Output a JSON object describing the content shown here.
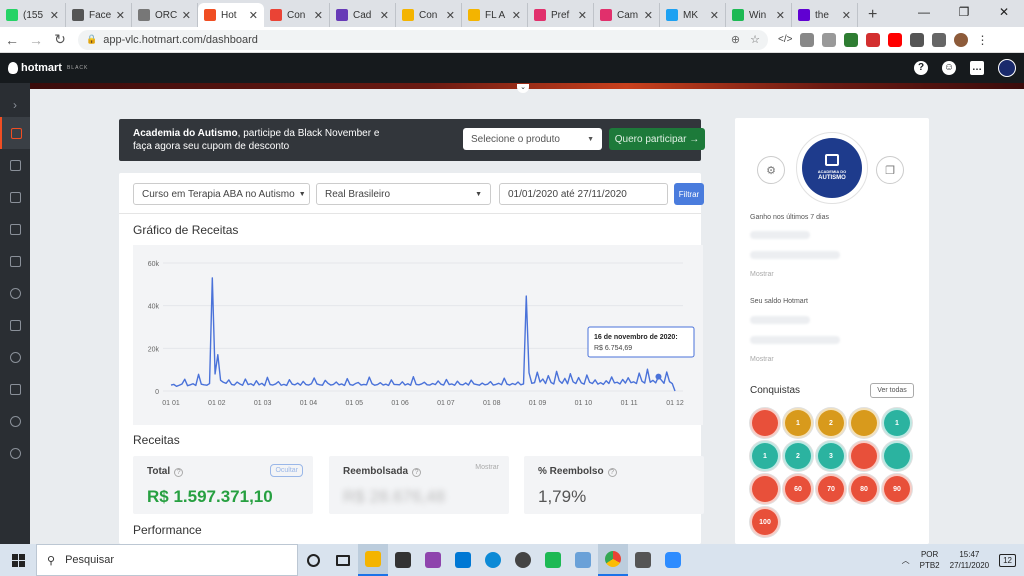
{
  "browser": {
    "tabs": [
      {
        "label": "(155",
        "color": "#25d366"
      },
      {
        "label": "Face",
        "color": "#555555"
      },
      {
        "label": "ORC",
        "color": "#777777"
      },
      {
        "label": "Hot",
        "color": "#f04e23"
      },
      {
        "label": "Con",
        "color": "#ea4335"
      },
      {
        "label": "Cad",
        "color": "#673ab7"
      },
      {
        "label": "Con",
        "color": "#f4b400"
      },
      {
        "label": "FL A",
        "color": "#f4b400"
      },
      {
        "label": "Pref",
        "color": "#e1306c"
      },
      {
        "label": "Cam",
        "color": "#e1306c"
      },
      {
        "label": "MK",
        "color": "#1da1f2"
      },
      {
        "label": "Win",
        "color": "#1db954"
      },
      {
        "label": "the",
        "color": "#6001d2"
      }
    ],
    "active_tab_index": 3,
    "new_tab": "+",
    "url": "app-vlc.hotmart.com/dashboard"
  },
  "header": {
    "logo": "hotmart",
    "logo_sub": "BLACK"
  },
  "banner": {
    "bold": "Academia do Autismo",
    "text": ", participe da Black November e faça agora seu cupom de desconto",
    "product_select": "Selecione o produto",
    "cta": "Quero participar →"
  },
  "filters": {
    "product": "Curso em Terapia ABA no Autismo",
    "currency": "Real Brasileiro",
    "date_range": "01/01/2020 até 27/11/2020",
    "filter_button": "Filtrar"
  },
  "chart_title": "Gráfico de Receitas",
  "chart_data": {
    "type": "line",
    "x_ticks": [
      "01 01",
      "01 02",
      "01 03",
      "01 04",
      "01 05",
      "01 06",
      "01 07",
      "01 08",
      "01 09",
      "01 10",
      "01 11",
      "01 12"
    ],
    "y_ticks": [
      "0",
      "20k",
      "40k",
      "60k"
    ],
    "ylim": [
      0,
      60000
    ],
    "color": "#4a72d9",
    "series": [
      {
        "values": [
          2800,
          3100,
          2200,
          2700,
          3300,
          5500,
          2500,
          2900,
          3400,
          2600,
          7800,
          3200,
          2900,
          2700,
          3500,
          53000,
          8000,
          17000,
          5000,
          4100,
          3600,
          5200,
          3100,
          2800,
          4200,
          3300,
          2700,
          5600,
          3000,
          3400,
          2600,
          4800,
          2900,
          3600,
          2500,
          6400,
          3000,
          2800,
          3300,
          4400,
          2700,
          3100,
          2600,
          5300,
          3200,
          2900,
          3700,
          2700,
          4500,
          3000,
          2800,
          3400,
          6100,
          3300,
          2900,
          2700,
          5000,
          3600,
          2800,
          3100,
          4200,
          2900,
          3300,
          2600,
          5800,
          3000,
          2700,
          3500,
          4000,
          2800,
          3100,
          2900,
          6500,
          3400,
          2700,
          3000,
          3900,
          2800,
          3200,
          2600,
          5200,
          3100,
          3000,
          2900,
          4300,
          2800,
          3400,
          2700,
          6700,
          3100,
          2900,
          3300,
          4100,
          2900,
          2800,
          3500,
          3000,
          4700,
          3200,
          2800,
          5400,
          3000,
          3300,
          2700,
          4600,
          3100,
          2900,
          3800,
          2800,
          5100,
          3300,
          3000,
          2700,
          3700,
          2900,
          3200,
          4400,
          2800,
          3100,
          3600,
          2900,
          6000,
          3200,
          2800,
          3500,
          3000,
          4200,
          2900,
          3300,
          44500,
          8500,
          3600,
          3900,
          8800,
          4200,
          5600,
          3500,
          7200,
          4000,
          3300,
          9200,
          4800,
          3600,
          5900,
          3400,
          8100,
          4300,
          3500,
          6300,
          3800,
          3200,
          7500,
          4100,
          3500,
          5200,
          3200,
          3900,
          3100,
          4800,
          3500,
          6600,
          3800,
          4100,
          3300,
          5400,
          3700,
          6200,
          3900,
          4300,
          3500,
          8400,
          4600,
          3700,
          10200,
          4100,
          5000,
          3800,
          6754,
          5200,
          3600,
          8900,
          4400,
          3500,
          0
        ]
      }
    ],
    "tooltip": {
      "date": "16 de novembro de 2020:",
      "value": "R$ 6.754,69"
    }
  },
  "receitas": {
    "title": "Receitas",
    "total_label": "Total",
    "total_value": "R$ 1.597.371,10",
    "total_action": "Ocultar",
    "refunded_label": "Reembolsada",
    "refunded_value": "R$ 28.676,48",
    "refunded_action": "Mostrar",
    "refund_pct_label": "% Reembolso",
    "refund_pct_value": "1,79%"
  },
  "performance_title": "Performance",
  "profile": {
    "avatar_line1": "ACADEMIA DO",
    "avatar_line2": "AUTISMO",
    "week_label": "Ganho nos últimos 7 dias",
    "week_show": "Mostrar",
    "balance_label": "Seu saldo Hotmart",
    "balance_show": "Mostrar",
    "achievements": "Conquistas",
    "see_all": "Ver todas",
    "badges": [
      {
        "label": "",
        "color": "#e8503a"
      },
      {
        "label": "1",
        "color": "#d89a1c"
      },
      {
        "label": "2",
        "color": "#d89a1c"
      },
      {
        "label": "",
        "color": "#d89a1c"
      },
      {
        "label": "1",
        "color": "#2bb3a0"
      },
      {
        "label": "1",
        "color": "#2bb3a0"
      },
      {
        "label": "2",
        "color": "#2bb3a0"
      },
      {
        "label": "3",
        "color": "#2bb3a0"
      },
      {
        "label": "",
        "color": "#e8503a"
      },
      {
        "label": "",
        "color": "#2bb3a0"
      },
      {
        "label": "",
        "color": "#e8503a"
      },
      {
        "label": "60",
        "color": "#e8503a"
      },
      {
        "label": "70",
        "color": "#e8503a"
      },
      {
        "label": "80",
        "color": "#e8503a"
      },
      {
        "label": "90",
        "color": "#e8503a"
      },
      {
        "label": "100",
        "color": "#e8503a"
      }
    ]
  },
  "taskbar": {
    "search_placeholder": "Pesquisar",
    "lang1": "POR",
    "lang2": "PTB2",
    "time": "15:47",
    "date": "27/11/2020",
    "notif": "12"
  }
}
